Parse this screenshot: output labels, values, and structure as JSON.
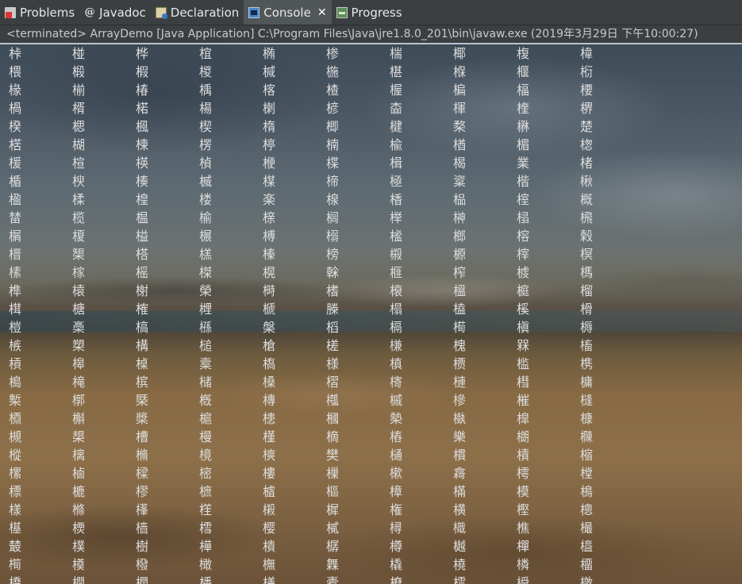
{
  "tabs": [
    {
      "label": "Problems",
      "icon": "problems-icon",
      "active": false
    },
    {
      "label": "Javadoc",
      "icon": "javadoc-icon",
      "active": false
    },
    {
      "label": "Declaration",
      "icon": "declaration-icon",
      "active": false
    },
    {
      "label": "Console",
      "icon": "console-icon",
      "active": true,
      "close_glyph": "✕"
    },
    {
      "label": "Progress",
      "icon": "progress-icon",
      "active": false
    }
  ],
  "console": {
    "status_text": "<terminated> ArrayDemo [Java Application] C:\\Program Files\\Java\\jre1.8.0_201\\bin\\javaw.exe (2019年3月29日 下午10:00:27)",
    "rows": [
      [
        "桛",
        "椪",
        "桦",
        "椬",
        "椭",
        "椮",
        "椯",
        "椰",
        "椱",
        "椲"
      ],
      [
        "椳",
        "椴",
        "椵",
        "椶",
        "椷",
        "椸",
        "椹",
        "椺",
        "椻",
        "椼"
      ],
      [
        "椽",
        "椾",
        "椿",
        "楀",
        "楁",
        "楂",
        "楃",
        "楄",
        "楅",
        "楆"
      ],
      [
        "楇",
        "楈",
        "楉",
        "楊",
        "楋",
        "楌",
        "楍",
        "楎",
        "楏",
        "楐"
      ],
      [
        "楑",
        "楒",
        "楓",
        "楔",
        "楕",
        "楖",
        "楗",
        "楘",
        "楙",
        "楚"
      ],
      [
        "楛",
        "楜",
        "楝",
        "楞",
        "楟",
        "楠",
        "楡",
        "楢",
        "楣",
        "楤"
      ],
      [
        "楥",
        "楦",
        "楧",
        "楨",
        "楩",
        "楪",
        "楫",
        "楬",
        "業",
        "楮"
      ],
      [
        "楯",
        "楰",
        "楱",
        "楲",
        "楳",
        "楴",
        "極",
        "楶",
        "楷",
        "楸"
      ],
      [
        "楹",
        "楺",
        "楻",
        "楼",
        "楽",
        "楾",
        "楿",
        "榀",
        "榁",
        "概"
      ],
      [
        "榃",
        "榄",
        "榅",
        "榆",
        "榇",
        "榈",
        "榉",
        "榊",
        "榋",
        "榌"
      ],
      [
        "榍",
        "榎",
        "榏",
        "榐",
        "榑",
        "榒",
        "榓",
        "榔",
        "榕",
        "榖"
      ],
      [
        "榗",
        "榘",
        "榙",
        "榚",
        "榛",
        "榜",
        "榝",
        "榞",
        "榟",
        "榠"
      ],
      [
        "榡",
        "榢",
        "榣",
        "榤",
        "榥",
        "榦",
        "榧",
        "榨",
        "榩",
        "榪"
      ],
      [
        "榫",
        "榬",
        "榭",
        "榮",
        "榯",
        "榰",
        "榱",
        "榲",
        "榳",
        "榴"
      ],
      [
        "榵",
        "榶",
        "榷",
        "榸",
        "榹",
        "榺",
        "榻",
        "榼",
        "榽",
        "榾"
      ],
      [
        "榿",
        "槀",
        "槁",
        "槂",
        "槃",
        "槄",
        "槅",
        "槆",
        "槇",
        "槈"
      ],
      [
        "槉",
        "槊",
        "構",
        "槌",
        "槍",
        "槎",
        "槏",
        "槐",
        "槑",
        "槒"
      ],
      [
        "槓",
        "槔",
        "槕",
        "槖",
        "槗",
        "様",
        "槙",
        "槚",
        "槛",
        "槜"
      ],
      [
        "槝",
        "槞",
        "槟",
        "槠",
        "槡",
        "槢",
        "槣",
        "槤",
        "槥",
        "槦"
      ],
      [
        "槧",
        "槨",
        "槩",
        "槪",
        "槫",
        "槬",
        "槭",
        "槮",
        "槯",
        "槰"
      ],
      [
        "槱",
        "槲",
        "槳",
        "槴",
        "槵",
        "槶",
        "槷",
        "槸",
        "槹",
        "槺"
      ],
      [
        "槻",
        "槼",
        "槽",
        "槾",
        "槿",
        "樀",
        "樁",
        "樂",
        "樃",
        "樄"
      ],
      [
        "樅",
        "樆",
        "樇",
        "樈",
        "樉",
        "樊",
        "樋",
        "樌",
        "樍",
        "樎"
      ],
      [
        "樏",
        "樐",
        "樑",
        "樒",
        "樓",
        "樔",
        "樕",
        "樖",
        "樗",
        "樘"
      ],
      [
        "標",
        "樚",
        "樛",
        "樜",
        "樝",
        "樞",
        "樟",
        "樠",
        "模",
        "樢"
      ],
      [
        "樣",
        "樤",
        "樥",
        "樦",
        "樧",
        "樨",
        "権",
        "横",
        "樫",
        "樬"
      ],
      [
        "樭",
        "樮",
        "樯",
        "樰",
        "樱",
        "樲",
        "樳",
        "樴",
        "樵",
        "樶"
      ],
      [
        "樷",
        "樸",
        "樹",
        "樺",
        "樻",
        "樼",
        "樽",
        "樾",
        "樿",
        "橀"
      ],
      [
        "橁",
        "橂",
        "橃",
        "橄",
        "橅",
        "橆",
        "橇",
        "橈",
        "橉",
        "橊"
      ],
      [
        "橋",
        "橌",
        "橍",
        "橎",
        "橏",
        "橐",
        "橑",
        "橒",
        "橓",
        "橔"
      ]
    ]
  }
}
